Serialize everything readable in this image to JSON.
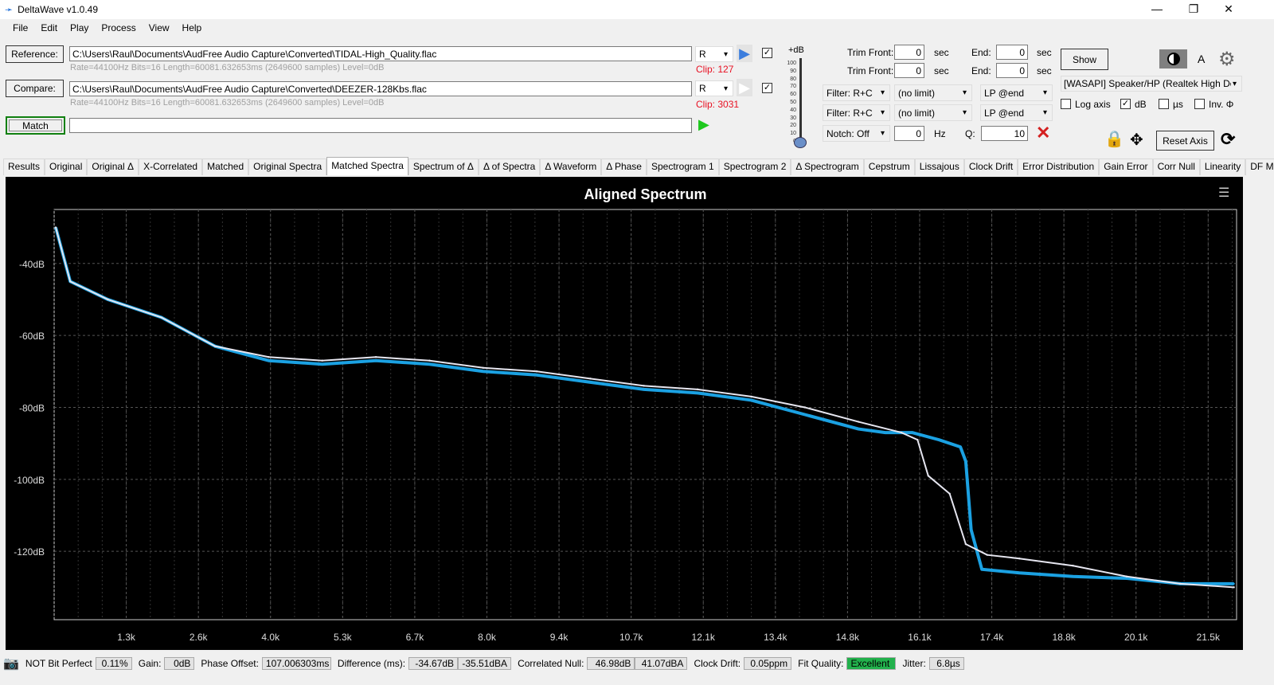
{
  "window": {
    "title": "DeltaWave v1.0.49",
    "minimize": "—",
    "restore": "❐",
    "close": "✕"
  },
  "menu": [
    "File",
    "Edit",
    "Play",
    "Process",
    "View",
    "Help"
  ],
  "reference": {
    "label": "Reference:",
    "path": "C:\\Users\\Raul\\Documents\\AudFree Audio Capture\\Converted\\TIDAL-High_Quality.flac",
    "info": "Rate=44100Hz Bits=16 Length=60081.632653ms (2649600 samples) Level=0dB",
    "channel": "R",
    "clip": "Clip: 127",
    "checked": true
  },
  "compare": {
    "label": "Compare:",
    "path": "C:\\Users\\Raul\\Documents\\AudFree Audio Capture\\Converted\\DEEZER-128Kbs.flac",
    "info": "Rate=44100Hz Bits=16 Length=60081.632653ms (2649600 samples) Level=0dB",
    "channel": "R",
    "clip": "Clip: 3031",
    "checked": true
  },
  "match": {
    "label": "Match",
    "value": ""
  },
  "gain_slider": {
    "label": "+dB",
    "ticks": [
      "100",
      "90",
      "80",
      "70",
      "60",
      "50",
      "40",
      "30",
      "20",
      "10",
      "0"
    ],
    "value": 0
  },
  "trim": [
    {
      "front_label": "Trim Front:",
      "front": "0",
      "unit": "sec",
      "end_label": "End:",
      "end": "0",
      "end_unit": "sec"
    },
    {
      "front_label": "Trim Front:",
      "front": "0",
      "unit": "sec",
      "end_label": "End:",
      "end": "0",
      "end_unit": "sec"
    }
  ],
  "filters": [
    {
      "filter": "Filter: R+C",
      "limit": "(no limit)",
      "lp": "LP @end"
    },
    {
      "filter": "Filter: R+C",
      "limit": "(no limit)",
      "lp": "LP @end"
    }
  ],
  "notch": {
    "label": "Notch: Off",
    "hz": "0",
    "hz_unit": "Hz",
    "q_label": "Q:",
    "q": "10"
  },
  "right": {
    "show": "Show",
    "font_label": "A",
    "device": "[WASAPI] Speaker/HP (Realtek High Defini",
    "log_axis": "Log axis",
    "log_axis_checked": false,
    "db": "dB",
    "db_checked": true,
    "us": "µs",
    "us_checked": false,
    "inv": "Inv. Φ",
    "inv_checked": false,
    "reset_axis": "Reset Axis"
  },
  "tabs": [
    "Results",
    "Original",
    "Original Δ",
    "X-Correlated",
    "Matched",
    "Original Spectra",
    "Matched Spectra",
    "Spectrum of Δ",
    "Δ of Spectra",
    "Δ Waveform",
    "Δ Phase",
    "Spectrogram 1",
    "Spectrogram 2",
    "Δ Spectrogram",
    "Cepstrum",
    "Lissajous",
    "Clock Drift",
    "Error Distribution",
    "Gain Error",
    "Corr Null",
    "Linearity",
    "DF Metric"
  ],
  "active_tab": "Matched Spectra",
  "chart_data": {
    "type": "line",
    "title": "Aligned Spectrum",
    "xlim": [
      0,
      22050
    ],
    "ylim": [
      -139,
      -25
    ],
    "grid": true,
    "xticks": [
      "1.3k",
      "2.6k",
      "4.0k",
      "5.3k",
      "6.7k",
      "8.0k",
      "9.4k",
      "10.7k",
      "12.1k",
      "13.4k",
      "14.8k",
      "16.1k",
      "17.4k",
      "18.8k",
      "20.1k",
      "21.5k"
    ],
    "xtick_values": [
      1345,
      2690,
      4035,
      5380,
      6725,
      8070,
      9415,
      10760,
      12105,
      13450,
      14795,
      16140,
      17485,
      18830,
      20175,
      21520
    ],
    "yticks": [
      "-40dB",
      "-60dB",
      "-80dB",
      "-100dB",
      "-120dB"
    ],
    "ytick_values": [
      -40,
      -60,
      -80,
      -100,
      -120
    ],
    "series": [
      {
        "color": "#1ba1e2",
        "x": [
          30,
          300,
          1000,
          2000,
          3000,
          4000,
          5000,
          6000,
          7000,
          8000,
          9000,
          10000,
          11000,
          12000,
          13000,
          14000,
          15000,
          15500,
          16000,
          16500,
          16900,
          17000,
          17100,
          17300,
          18000,
          19000,
          20000,
          21000,
          22000
        ],
        "y": [
          -30,
          -45,
          -50,
          -55,
          -63,
          -67,
          -68,
          -67,
          -68,
          -70,
          -71,
          -73,
          -75,
          -76,
          -78,
          -82,
          -86,
          -87,
          -87,
          -89,
          -91,
          -95,
          -114,
          -125,
          -126,
          -127,
          -127.5,
          -129,
          -129
        ]
      },
      {
        "color": "#e6e6f0",
        "x": [
          30,
          300,
          1000,
          2000,
          3000,
          4000,
          5000,
          6000,
          7000,
          8000,
          9000,
          10000,
          11000,
          12000,
          13000,
          14000,
          15000,
          15800,
          16100,
          16300,
          16700,
          17000,
          17400,
          18000,
          19000,
          20000,
          21000,
          22000
        ],
        "y": [
          -30,
          -45,
          -50,
          -55,
          -63,
          -66,
          -67,
          -66,
          -67,
          -69,
          -70,
          -72,
          -74,
          -75,
          -77,
          -80,
          -84,
          -87,
          -89,
          -99,
          -104,
          -118,
          -121,
          -122,
          -124,
          -127,
          -129,
          -130
        ]
      }
    ]
  },
  "status": {
    "bit_perfect": "NOT Bit Perfect",
    "bit_perfect_val": "0.11%",
    "gain_label": "Gain:",
    "gain": "0dB",
    "phase_label": "Phase Offset:",
    "phase": "107.006303ms",
    "diff_label": "Difference (ms):",
    "diff1": "-34.67dB",
    "diff2": "-35.51dBA",
    "null_label": "Correlated Null:",
    "null1": "46.98dB",
    "null2": "41.07dBA",
    "drift_label": "Clock Drift:",
    "drift": "0.05ppm",
    "fit_label": "Fit Quality:",
    "fit": "Excellent",
    "fit_color": "#22b14c",
    "jitter_label": "Jitter:",
    "jitter": "6.8µs"
  }
}
